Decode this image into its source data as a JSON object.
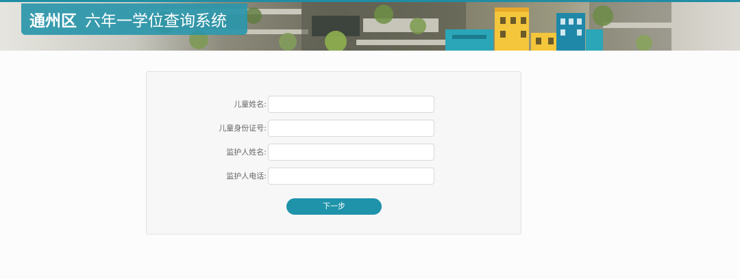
{
  "header": {
    "district": "通州区",
    "system_name": "六年一学位查询系统"
  },
  "form": {
    "fields": [
      {
        "label": "儿童姓名:",
        "value": "",
        "placeholder": ""
      },
      {
        "label": "儿童身份证号:",
        "value": "",
        "placeholder": ""
      },
      {
        "label": "监护人姓名:",
        "value": "",
        "placeholder": ""
      },
      {
        "label": "监护人电话:",
        "value": "",
        "placeholder": ""
      }
    ],
    "next_label": "下一步"
  },
  "colors": {
    "accent": "#1e93aa",
    "header_box": "#2a96aa",
    "background": "#fcfcfc"
  }
}
